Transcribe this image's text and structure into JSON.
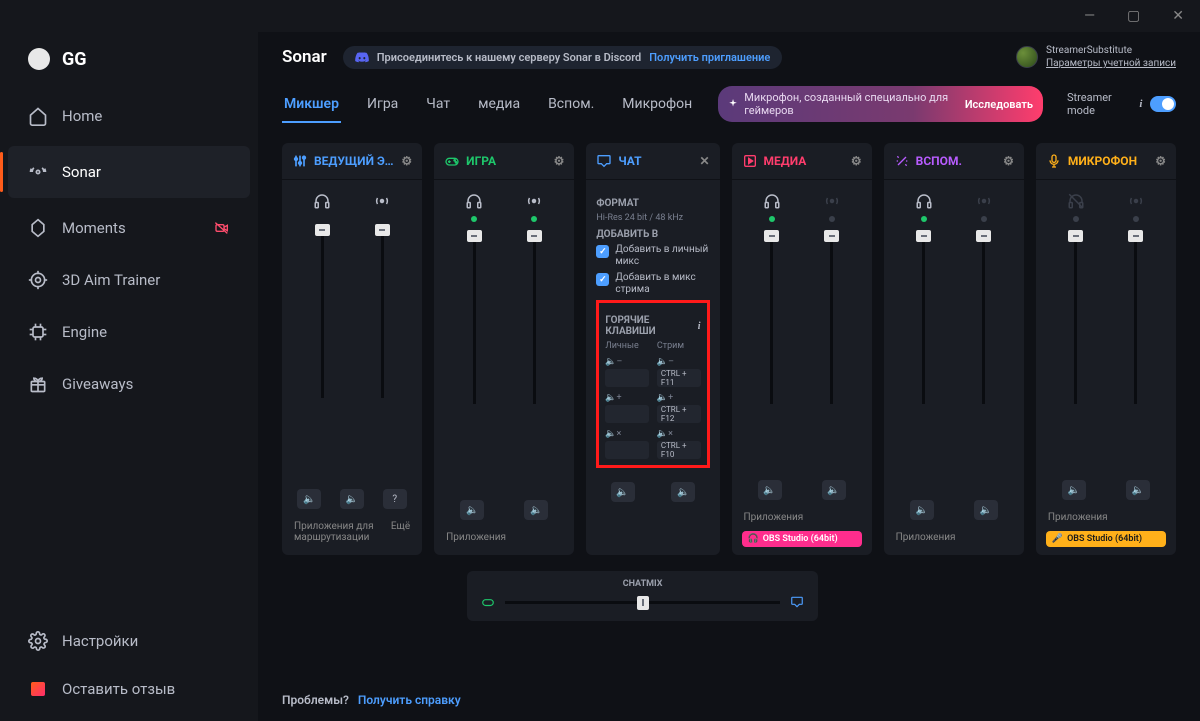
{
  "titlebar": {
    "min": "—",
    "max": "▢",
    "close": "✕"
  },
  "logo": "GG",
  "sidebar": {
    "items": [
      {
        "label": "Home"
      },
      {
        "label": "Sonar"
      },
      {
        "label": "Moments"
      },
      {
        "label": "3D Aim Trainer"
      },
      {
        "label": "Engine"
      },
      {
        "label": "Giveaways"
      }
    ],
    "settings": "Настройки",
    "feedback": "Оставить отзыв"
  },
  "header": {
    "app": "Sonar",
    "discord_join": "Присоединитесь к нашему серверу Sonar в Discord",
    "discord_link": "Получить приглашение",
    "user_name": "StreamerSubstitute",
    "user_settings": "Параметры учетной записи"
  },
  "tabs": [
    "Микшер",
    "Игра",
    "Чат",
    "медиа",
    "Вспом.",
    "Микрофон"
  ],
  "promo": {
    "text": "Микрофон, созданный специально для геймеров",
    "cta": "Исследовать"
  },
  "streamer_mode": "Streamer mode",
  "channels": {
    "master": {
      "title": "ВЕДУЩИЙ ЭЛЕМЕ!",
      "apps_label": "Приложения для маршрутизации",
      "more": "Ещё"
    },
    "game": {
      "title": "ИГРА",
      "apps_label": "Приложения"
    },
    "chat": {
      "title": "ЧАТ",
      "format_label": "ФОРМАТ",
      "format_value": "Hi-Res 24 bit / 48 kHz",
      "add_to_label": "ДОБАВИТЬ В",
      "add_personal": "Добавить в личный микс",
      "add_stream": "Добавить в микс стрима",
      "hotkeys_label": "ГОРЯЧИЕ КЛАВИШИ",
      "col_personal": "Личные",
      "col_stream": "Стрим",
      "vol_down": "🔈–",
      "vol_up": "🔈+",
      "vol_mute": "🔈×",
      "hk_f11": "CTRL + F11",
      "hk_f12": "CTRL + F12",
      "hk_f10": "CTRL + F10"
    },
    "media": {
      "title": "МЕДИА",
      "apps_label": "Приложения",
      "app_chip": "OBS Studio (64bit)"
    },
    "aux": {
      "title": "ВСПОМ.",
      "apps_label": "Приложения"
    },
    "mic": {
      "title": "МИКРОФОН",
      "apps_label": "Приложения",
      "app_chip": "OBS Studio (64bit)"
    }
  },
  "chatmix": {
    "label": "CHATMIX"
  },
  "footer": {
    "problems": "Проблемы?",
    "help": "Получить справку"
  }
}
